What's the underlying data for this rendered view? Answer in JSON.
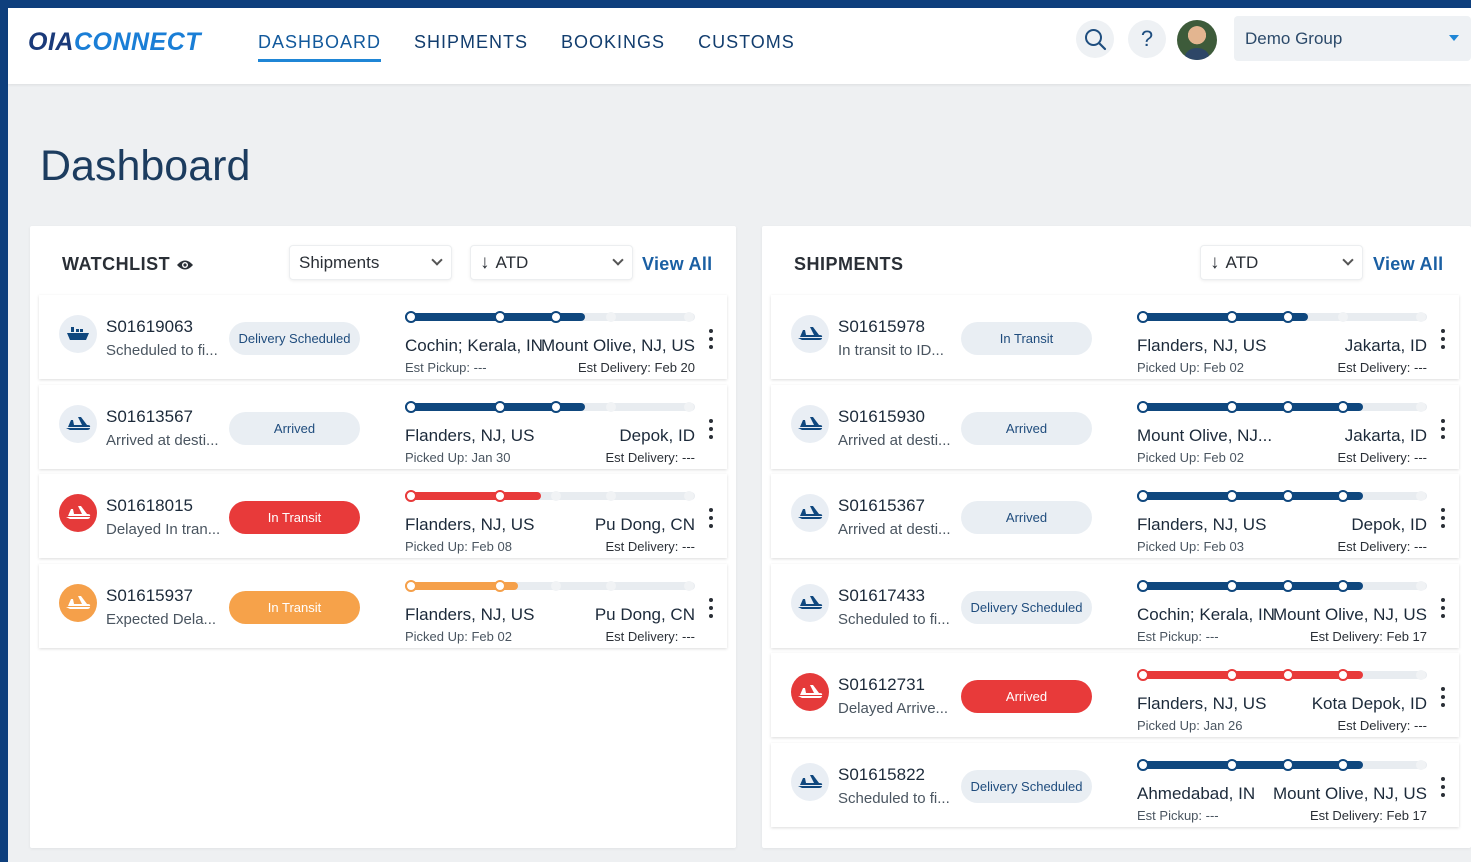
{
  "brand": {
    "part1": "OIA",
    "part2": "CONNECT"
  },
  "nav": {
    "items": [
      "DASHBOARD",
      "SHIPMENTS",
      "BOOKINGS",
      "CUSTOMS"
    ],
    "active": "DASHBOARD"
  },
  "header": {
    "search_icon": "search-icon",
    "help_symbol": "?",
    "group": "Demo Group"
  },
  "page": {
    "title": "Dashboard"
  },
  "colors": {
    "navy": "#123d6e",
    "accent": "#1f86d6",
    "red": "#e83a3a",
    "orange": "#f6a24a"
  },
  "watchlist": {
    "title": "WATCHLIST",
    "type_filter": "Shipments",
    "sort": "ATD",
    "view_all": "View All",
    "rows": [
      {
        "id": "S01619063",
        "sub": "Scheduled to fi...",
        "badge": "Delivery Scheduled",
        "status_color": "normal",
        "icon": "ship-icon",
        "from": "Cochin; Kerala, IN",
        "to": "Mount Olive, NJ, US",
        "picked": "Est Pickup: ---",
        "est": "Est Delivery: Feb 20",
        "progress": 0.62
      },
      {
        "id": "S01613567",
        "sub": "Arrived at desti...",
        "badge": "Arrived",
        "status_color": "normal",
        "icon": "plane-icon",
        "from": "Flanders, NJ, US",
        "to": "Depok, ID",
        "picked": "Picked Up: Jan 30",
        "est": "Est Delivery: ---",
        "progress": 0.62
      },
      {
        "id": "S01618015",
        "sub": "Delayed In tran...",
        "badge": "In Transit",
        "status_color": "red",
        "icon": "plane-icon",
        "from": "Flanders, NJ, US",
        "to": "Pu Dong, CN",
        "picked": "Picked Up: Feb 08",
        "est": "Est Delivery: ---",
        "progress": 0.47
      },
      {
        "id": "S01615937",
        "sub": "Expected Dela...",
        "badge": "In Transit",
        "status_color": "orange",
        "icon": "plane-icon",
        "from": "Flanders, NJ, US",
        "to": "Pu Dong, CN",
        "picked": "Picked Up: Feb 02",
        "est": "Est Delivery: ---",
        "progress": 0.39
      }
    ]
  },
  "shipments": {
    "title": "SHIPMENTS",
    "sort": "ATD",
    "view_all": "View All",
    "rows": [
      {
        "id": "S01615978",
        "sub": "In transit to ID...",
        "badge": "In Transit",
        "status_color": "normal",
        "icon": "plane-icon",
        "from": "Flanders, NJ, US",
        "to": "Jakarta, ID",
        "picked": "Picked Up: Feb 02",
        "est": "Est Delivery: ---",
        "progress": 0.59
      },
      {
        "id": "S01615930",
        "sub": "Arrived at desti...",
        "badge": "Arrived",
        "status_color": "normal",
        "icon": "plane-icon",
        "from": "Mount Olive, NJ...",
        "to": "Jakarta, ID",
        "picked": "Picked Up: Feb 02",
        "est": "Est Delivery: ---",
        "progress": 0.78
      },
      {
        "id": "S01615367",
        "sub": "Arrived at desti...",
        "badge": "Arrived",
        "status_color": "normal",
        "icon": "plane-icon",
        "from": "Flanders, NJ, US",
        "to": "Depok, ID",
        "picked": "Picked Up: Feb 03",
        "est": "Est Delivery: ---",
        "progress": 0.78
      },
      {
        "id": "S01617433",
        "sub": "Scheduled to fi...",
        "badge": "Delivery Scheduled",
        "status_color": "normal",
        "icon": "plane-icon",
        "from": "Cochin; Kerala, IN",
        "to": "Mount Olive, NJ, US",
        "picked": "Est Pickup: ---",
        "est": "Est Delivery: Feb 17",
        "progress": 0.78
      },
      {
        "id": "S01612731",
        "sub": "Delayed Arrive...",
        "badge": "Arrived",
        "status_color": "red",
        "icon": "plane-icon",
        "from": "Flanders, NJ, US",
        "to": "Kota Depok, ID",
        "picked": "Picked Up: Jan 26",
        "est": "Est Delivery: ---",
        "progress": 0.78
      },
      {
        "id": "S01615822",
        "sub": "Scheduled to fi...",
        "badge": "Delivery Scheduled",
        "status_color": "normal",
        "icon": "plane-icon",
        "from": "Ahmedabad, IN",
        "to": "Mount Olive, NJ, US",
        "picked": "Est Pickup: ---",
        "est": "Est Delivery: Feb 17",
        "progress": 0.78
      }
    ]
  }
}
